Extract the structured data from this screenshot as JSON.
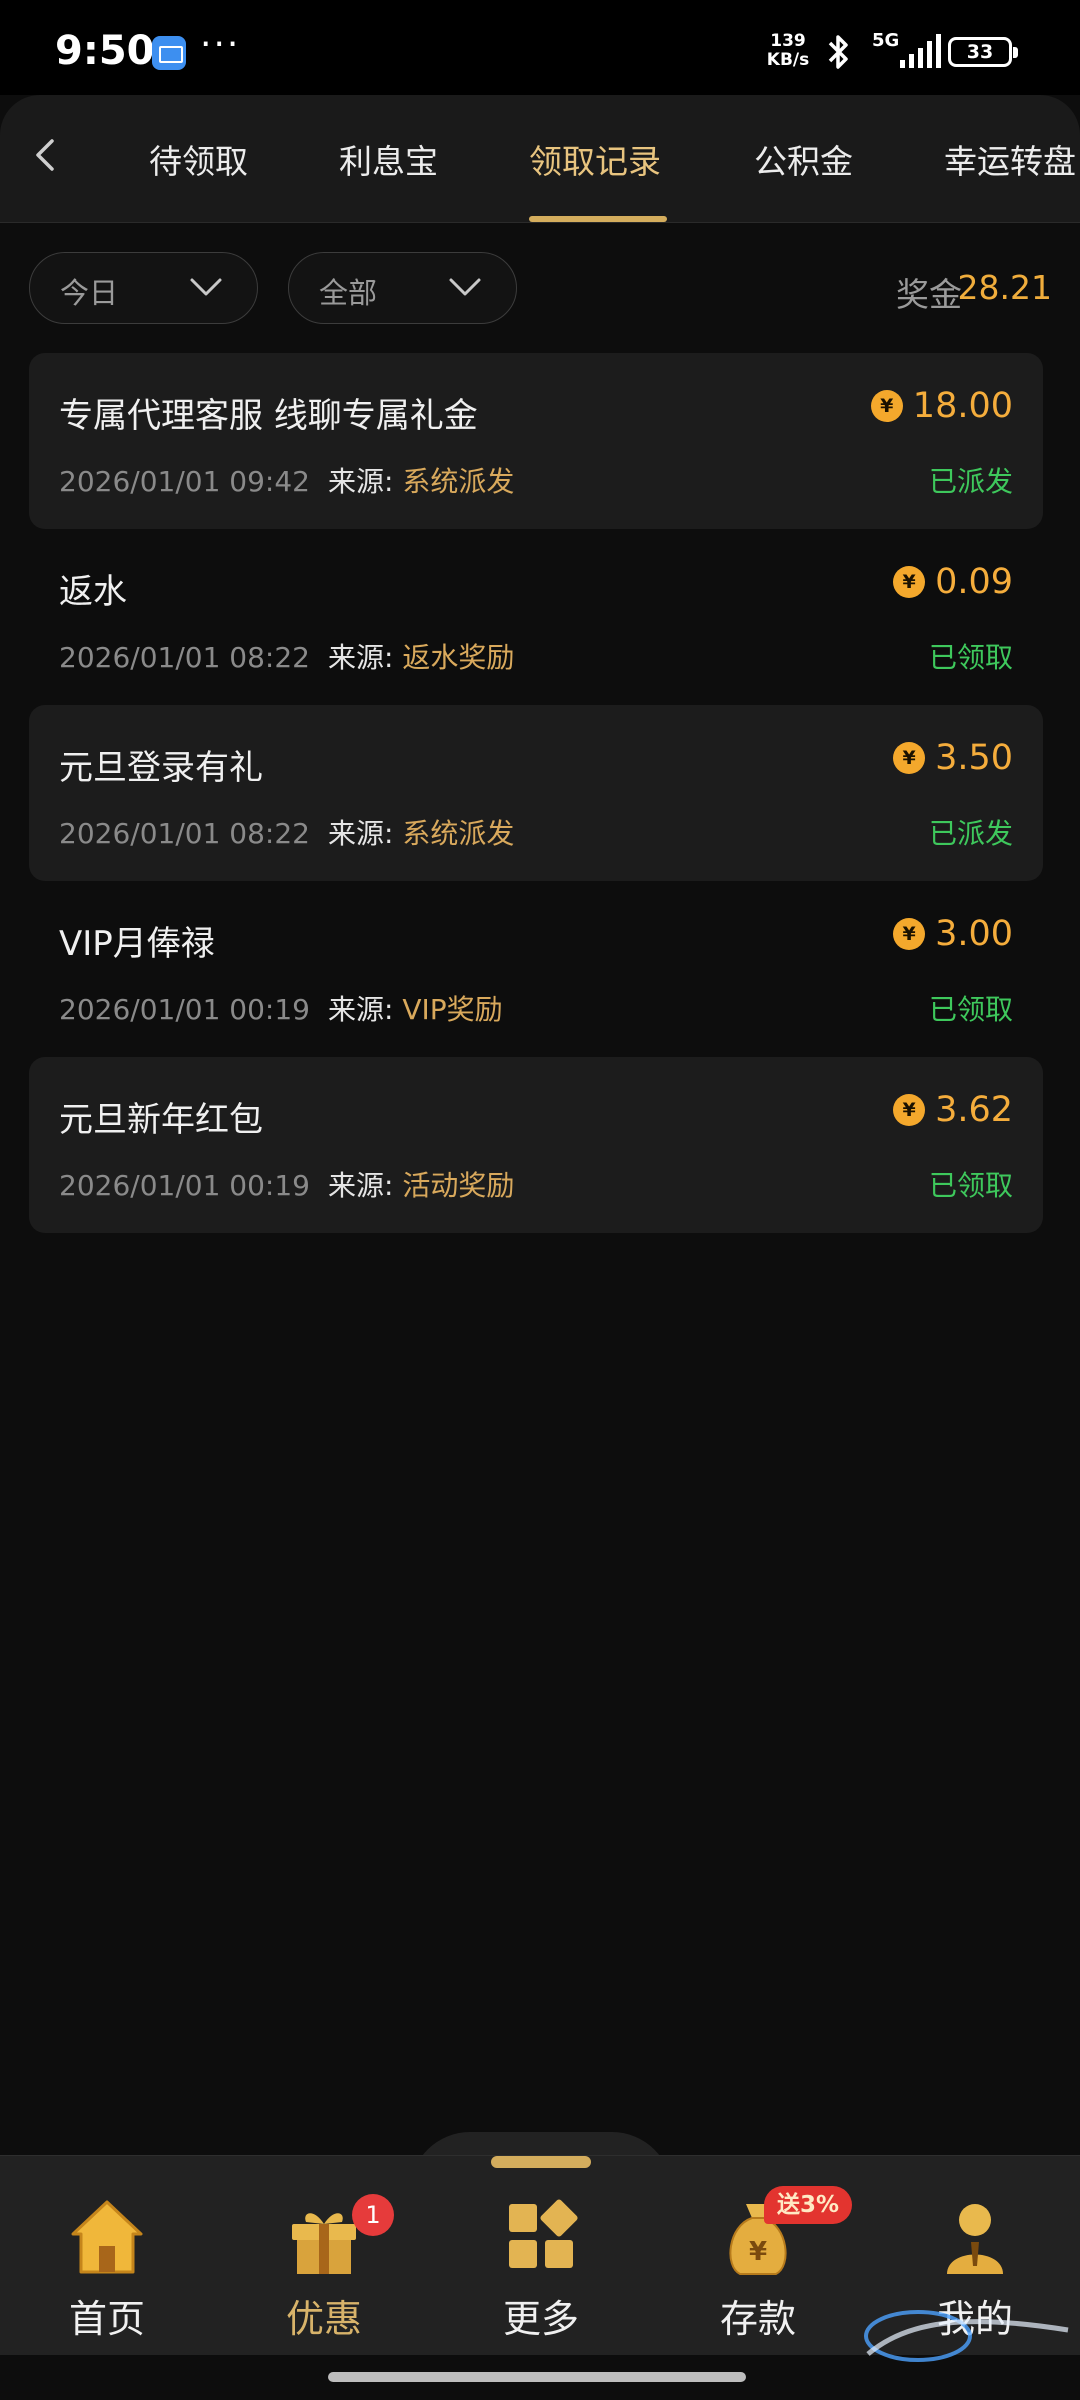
{
  "status_bar": {
    "time": "9:50",
    "dots": "···",
    "net_speed_value": "139",
    "net_speed_unit": "KB/s",
    "network": "5G",
    "battery": "33"
  },
  "tabs": [
    {
      "label": "待领取",
      "active": false
    },
    {
      "label": "利息宝",
      "active": false
    },
    {
      "label": "领取记录",
      "active": true
    },
    {
      "label": "公积金",
      "active": false
    },
    {
      "label": "幸运转盘",
      "active": false
    }
  ],
  "filters": {
    "date": "今日",
    "type": "全部"
  },
  "summary": {
    "label": "奖金",
    "value": "28.21"
  },
  "records": [
    {
      "title": "专属代理客服 线聊专属礼金",
      "amount": "18.00",
      "date": "2026/01/01 09:42",
      "source_label": "来源:",
      "source": "系统派发",
      "status": "已派发"
    },
    {
      "title": "返水",
      "amount": "0.09",
      "date": "2026/01/01 08:22",
      "source_label": "来源:",
      "source": "返水奖励",
      "status": "已领取"
    },
    {
      "title": "元旦登录有礼",
      "amount": "3.50",
      "date": "2026/01/01 08:22",
      "source_label": "来源:",
      "source": "系统派发",
      "status": "已派发"
    },
    {
      "title": "VIP月俸禄",
      "amount": "3.00",
      "date": "2026/01/01 00:19",
      "source_label": "来源:",
      "source": "VIP奖励",
      "status": "已领取"
    },
    {
      "title": "元旦新年红包",
      "amount": "3.62",
      "date": "2026/01/01 00:19",
      "source_label": "来源:",
      "source": "活动奖励",
      "status": "已领取"
    }
  ],
  "coin_symbol": "¥",
  "bottom_nav": [
    {
      "label": "首页",
      "icon": "home-icon"
    },
    {
      "label": "优惠",
      "icon": "gift-icon",
      "badge": "1"
    },
    {
      "label": "更多",
      "icon": "grid-icon"
    },
    {
      "label": "存款",
      "icon": "money-bag-icon",
      "tag": "送3%"
    },
    {
      "label": "我的",
      "icon": "user-icon"
    }
  ],
  "colors": {
    "accent_gold": "#d4ad5d",
    "amount_orange": "#f5ad3c",
    "status_green": "#3ec85c",
    "background": "#0d0d0d",
    "card": "#1c1c1c"
  }
}
